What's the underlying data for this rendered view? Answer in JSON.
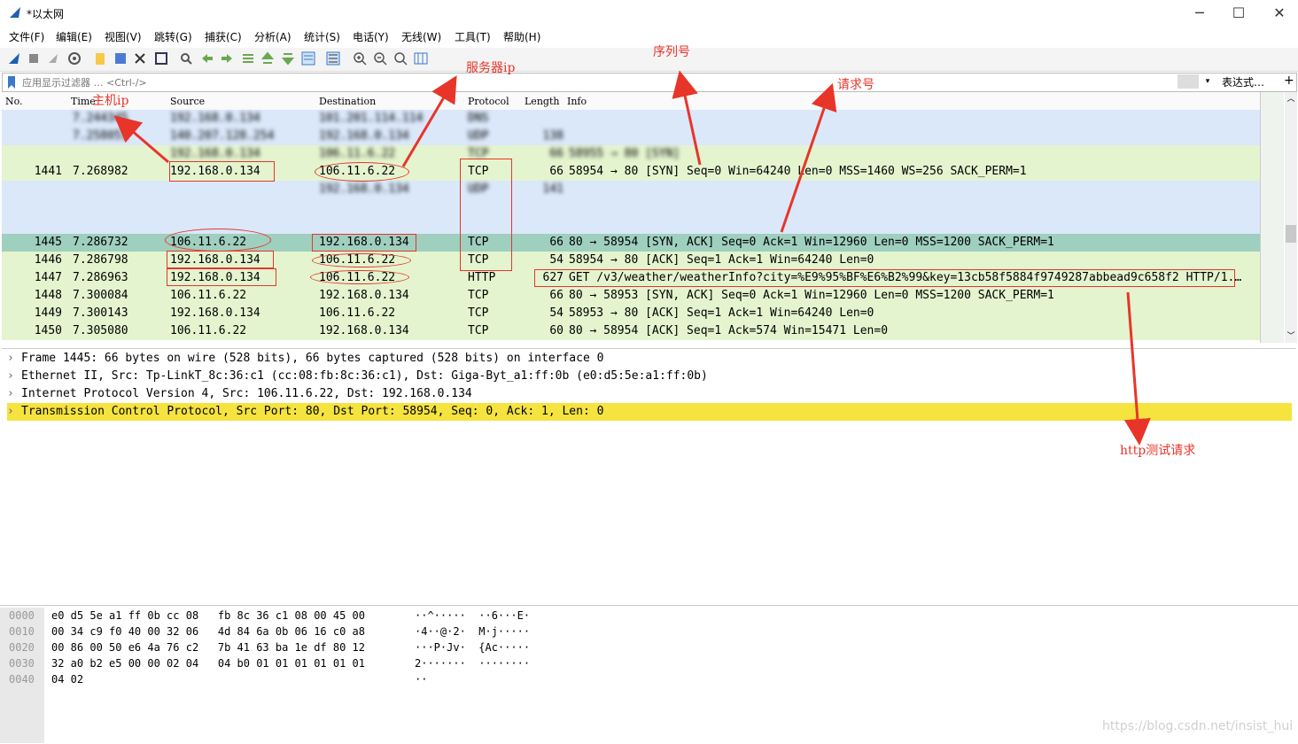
{
  "window": {
    "title": "*以太网",
    "minimize": "─",
    "maximize": "☐",
    "close": "✕"
  },
  "menu": [
    "文件(F)",
    "编辑(E)",
    "视图(V)",
    "跳转(G)",
    "捕获(C)",
    "分析(A)",
    "统计(S)",
    "电话(Y)",
    "无线(W)",
    "工具(T)",
    "帮助(H)"
  ],
  "filter": {
    "placeholder": "应用显示过滤器 … <Ctrl-/>",
    "expression_label": "表达式…",
    "add_label": "+"
  },
  "packet_list": {
    "columns": [
      "No.",
      "Time",
      "Source",
      "Destination",
      "Protocol",
      "Length",
      "Info"
    ],
    "rows": [
      {
        "no": "",
        "time": "7.244345",
        "source": "192.168.0.134",
        "destination": "101.201.114.114",
        "protocol": "DNS",
        "length": "",
        "info": "",
        "blurred": true,
        "bg": "#dae8fa"
      },
      {
        "no": "",
        "time": "7.258051",
        "source": "140.207.128.254",
        "destination": "192.168.0.134",
        "protocol": "UDP",
        "length": "138",
        "info": "",
        "blurred": true,
        "bg": "#dae8fa"
      },
      {
        "no": "",
        "time": "",
        "source": "192.168.0.134",
        "destination": "106.11.6.22",
        "protocol": "TCP",
        "length": "66",
        "info": "58955 → 80 [SYN]",
        "blurred": true,
        "bg": "#e4f4cf"
      },
      {
        "no": "1441",
        "time": "7.268982",
        "source": "192.168.0.134",
        "destination": "106.11.6.22",
        "protocol": "TCP",
        "length": "66",
        "info": "58954 → 80 [SYN] Seq=0 Win=64240 Len=0 MSS=1460 WS=256 SACK_PERM=1",
        "blurred": false,
        "bg": "#e4f4cf"
      },
      {
        "no": "",
        "time": "",
        "source": "",
        "destination": "192.168.0.134",
        "protocol": "UDP",
        "length": "141",
        "info": "",
        "blurred": true,
        "bg": "#dae8fa"
      },
      {
        "no": "",
        "time": "",
        "source": "",
        "destination": "",
        "protocol": "",
        "length": "",
        "info": "",
        "blurred": true,
        "bg": "#dae8fa"
      },
      {
        "no": "",
        "time": "",
        "source": "",
        "destination": "",
        "protocol": "",
        "length": "",
        "info": "",
        "blurred": true,
        "bg": "#dae8fa"
      },
      {
        "no": "1445",
        "time": "7.286732",
        "source": "106.11.6.22",
        "destination": "192.168.0.134",
        "protocol": "TCP",
        "length": "66",
        "info": "80 → 58954 [SYN, ACK] Seq=0 Ack=1 Win=12960 Len=0 MSS=1200 SACK_PERM=1",
        "blurred": false,
        "bg": "#9fcfbf",
        "selected": true
      },
      {
        "no": "1446",
        "time": "7.286798",
        "source": "192.168.0.134",
        "destination": "106.11.6.22",
        "protocol": "TCP",
        "length": "54",
        "info": "58954 → 80 [ACK] Seq=1 Ack=1 Win=64240 Len=0",
        "blurred": false,
        "bg": "#e4f4cf"
      },
      {
        "no": "1447",
        "time": "7.286963",
        "source": "192.168.0.134",
        "destination": "106.11.6.22",
        "protocol": "HTTP",
        "length": "627",
        "info": "GET /v3/weather/weatherInfo?city=%E9%95%BF%E6%B2%99&key=13cb58f5884f9749287abbead9c658f2 HTTP/1.…",
        "blurred": false,
        "bg": "#e4f4cf"
      },
      {
        "no": "1448",
        "time": "7.300084",
        "source": "106.11.6.22",
        "destination": "192.168.0.134",
        "protocol": "TCP",
        "length": "66",
        "info": "80 → 58953 [SYN, ACK] Seq=0 Ack=1 Win=12960 Len=0 MSS=1200 SACK_PERM=1",
        "blurred": false,
        "bg": "#e4f4cf"
      },
      {
        "no": "1449",
        "time": "7.300143",
        "source": "192.168.0.134",
        "destination": "106.11.6.22",
        "protocol": "TCP",
        "length": "54",
        "info": "58953 → 80 [ACK] Seq=1 Ack=1 Win=64240 Len=0",
        "blurred": false,
        "bg": "#e4f4cf"
      },
      {
        "no": "1450",
        "time": "7.305080",
        "source": "106.11.6.22",
        "destination": "192.168.0.134",
        "protocol": "TCP",
        "length": "60",
        "info": "80 → 58954 [ACK] Seq=1 Ack=574 Win=15471 Len=0",
        "blurred": false,
        "bg": "#e4f4cf"
      }
    ]
  },
  "details": [
    {
      "text": "Frame 1445: 66 bytes on wire (528 bits), 66 bytes captured (528 bits) on interface 0",
      "highlight": false
    },
    {
      "text": "Ethernet II, Src: Tp-LinkT_8c:36:c1 (cc:08:fb:8c:36:c1), Dst: Giga-Byt_a1:ff:0b (e0:d5:5e:a1:ff:0b)",
      "highlight": false
    },
    {
      "text": "Internet Protocol Version 4, Src: 106.11.6.22, Dst: 192.168.0.134",
      "highlight": false
    },
    {
      "text": "Transmission Control Protocol, Src Port: 80, Dst Port: 58954, Seq: 0, Ack: 1, Len: 0",
      "highlight": true
    }
  ],
  "hex": [
    {
      "offset": "0000",
      "bytes": "e0 d5 5e a1 ff 0b cc 08   fb 8c 36 c1 08 00 45 00",
      "ascii": "··^·····  ··6···E·"
    },
    {
      "offset": "0010",
      "bytes": "00 34 c9 f0 40 00 32 06   4d 84 6a 0b 06 16 c0 a8",
      "ascii": "·4··@·2·  M·j·····"
    },
    {
      "offset": "0020",
      "bytes": "00 86 00 50 e6 4a 76 c2   7b 41 63 ba 1e df 80 12",
      "ascii": "···P·Jv·  {Ac·····"
    },
    {
      "offset": "0030",
      "bytes": "32 a0 b2 e5 00 00 02 04   04 b0 01 01 01 01 01 01",
      "ascii": "2·······  ········"
    },
    {
      "offset": "0040",
      "bytes": "04 02",
      "ascii": "··"
    }
  ],
  "annotations": {
    "host_ip": "主机ip",
    "server_ip": "服务器ip",
    "seq_no": "序列号",
    "ack_no": "请求号",
    "http_test": "http测试请求"
  },
  "watermark": "https://blog.csdn.net/insist_hui",
  "colors": {
    "tcp_row": "#e4f4cf",
    "udp_row": "#dae8fa",
    "selected_row": "#9fcfbf",
    "highlight": "#f5e33f",
    "annotation": "#e8352a"
  }
}
